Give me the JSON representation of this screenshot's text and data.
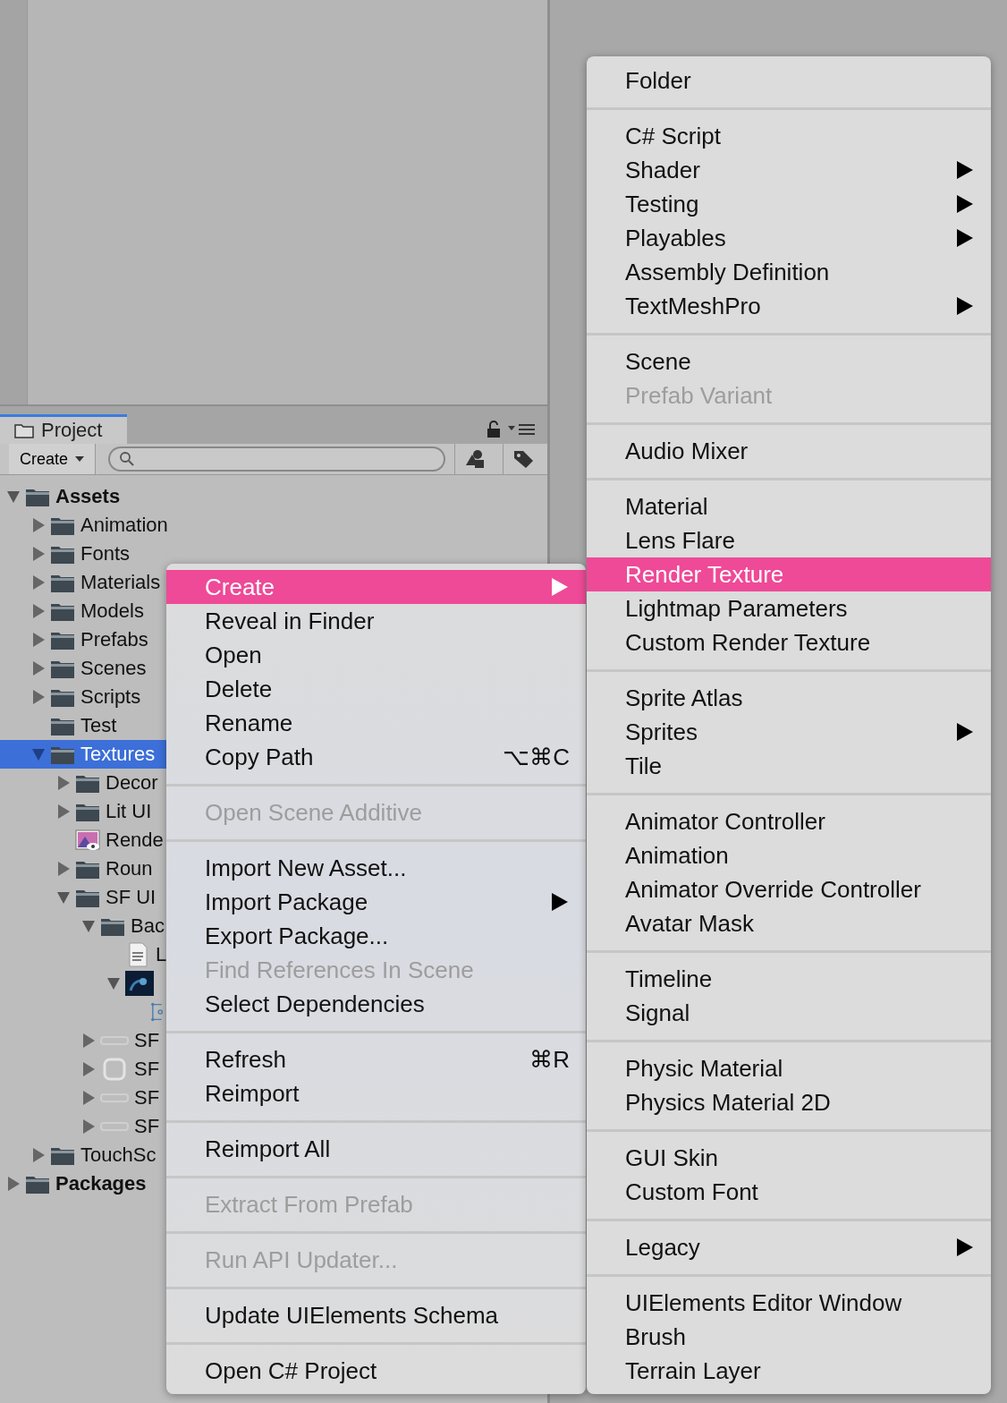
{
  "project": {
    "tab": {
      "label": "Project",
      "selected": true
    },
    "toolbar": {
      "create_label": "Create"
    },
    "tree": [
      {
        "label": "Assets",
        "kind": "folder",
        "expanded": true,
        "selected": false,
        "children": [
          {
            "label": "Animation",
            "kind": "folder",
            "expanded": false,
            "selected": false
          },
          {
            "label": "Fonts",
            "kind": "folder",
            "expanded": false,
            "selected": false
          },
          {
            "label": "Materials",
            "kind": "folder",
            "expanded": false,
            "selected": false
          },
          {
            "label": "Models",
            "kind": "folder",
            "expanded": false,
            "selected": false
          },
          {
            "label": "Prefabs",
            "kind": "folder",
            "expanded": false,
            "selected": false
          },
          {
            "label": "Scenes",
            "kind": "folder",
            "expanded": false,
            "selected": false
          },
          {
            "label": "Scripts",
            "kind": "folder",
            "expanded": false,
            "selected": false
          },
          {
            "label": "Test",
            "kind": "folder",
            "selected": false
          },
          {
            "label": "Textures",
            "kind": "folder",
            "expanded": true,
            "selected": true,
            "children": [
              {
                "label": "Decor",
                "kind": "folder",
                "expanded": false,
                "selected": false
              },
              {
                "label": "Lit UI",
                "kind": "folder",
                "expanded": false,
                "selected": false
              },
              {
                "label": "Rende",
                "kind": "render-texture",
                "selected": false
              },
              {
                "label": "Roun",
                "kind": "folder",
                "expanded": false,
                "selected": false
              },
              {
                "label": "SF UI",
                "kind": "folder",
                "expanded": true,
                "selected": false,
                "children": [
                  {
                    "label": "Bac",
                    "kind": "folder",
                    "expanded": true,
                    "selected": false,
                    "children": [
                      {
                        "label": "L",
                        "kind": "document",
                        "selected": false
                      },
                      {
                        "kind": "image",
                        "expanded": true,
                        "selected": false,
                        "children": [
                          {
                            "kind": "sprite",
                            "selected": false
                          }
                        ]
                      }
                    ]
                  },
                  {
                    "label": "SF",
                    "kind": "bar",
                    "expanded": false,
                    "selected": false
                  },
                  {
                    "label": "SF",
                    "kind": "frame",
                    "expanded": false,
                    "selected": false
                  },
                  {
                    "label": "SF",
                    "kind": "bar",
                    "expanded": false,
                    "selected": false
                  },
                  {
                    "label": "SF",
                    "kind": "bar",
                    "expanded": false,
                    "selected": false
                  }
                ]
              }
            ]
          },
          {
            "label": "TouchSc",
            "kind": "folder",
            "expanded": false,
            "selected": false
          }
        ]
      },
      {
        "label": "Packages",
        "kind": "folder",
        "expanded": false,
        "selected": false
      }
    ]
  },
  "context_menu": {
    "groups": [
      {
        "items": [
          {
            "label": "Create",
            "selected": true,
            "disabled": false,
            "submenu": true
          },
          {
            "label": "Reveal in Finder",
            "selected": false,
            "disabled": false,
            "submenu": false
          },
          {
            "label": "Open",
            "selected": false,
            "disabled": false,
            "submenu": false
          },
          {
            "label": "Delete",
            "selected": false,
            "disabled": false,
            "submenu": false
          },
          {
            "label": "Rename",
            "selected": false,
            "disabled": false,
            "submenu": false
          },
          {
            "label": "Copy Path",
            "shortcut": "⌥⌘C",
            "selected": false,
            "disabled": false,
            "submenu": false
          }
        ]
      },
      {
        "items": [
          {
            "label": "Open Scene Additive",
            "selected": false,
            "disabled": true,
            "submenu": false
          }
        ]
      },
      {
        "items": [
          {
            "label": "Import New Asset...",
            "selected": false,
            "disabled": false,
            "submenu": false
          },
          {
            "label": "Import Package",
            "selected": false,
            "disabled": false,
            "submenu": true
          },
          {
            "label": "Export Package...",
            "selected": false,
            "disabled": false,
            "submenu": false
          },
          {
            "label": "Find References In Scene",
            "selected": false,
            "disabled": true,
            "submenu": false
          },
          {
            "label": "Select Dependencies",
            "selected": false,
            "disabled": false,
            "submenu": false
          }
        ]
      },
      {
        "items": [
          {
            "label": "Refresh",
            "shortcut": "⌘R",
            "selected": false,
            "disabled": false,
            "submenu": false
          },
          {
            "label": "Reimport",
            "selected": false,
            "disabled": false,
            "submenu": false
          }
        ]
      },
      {
        "items": [
          {
            "label": "Reimport All",
            "selected": false,
            "disabled": false,
            "submenu": false
          }
        ]
      },
      {
        "items": [
          {
            "label": "Extract From Prefab",
            "selected": false,
            "disabled": true,
            "submenu": false
          }
        ]
      },
      {
        "items": [
          {
            "label": "Run API Updater...",
            "selected": false,
            "disabled": true,
            "submenu": false
          }
        ]
      },
      {
        "items": [
          {
            "label": "Update UIElements Schema",
            "selected": false,
            "disabled": false,
            "submenu": false
          }
        ]
      },
      {
        "items": [
          {
            "label": "Open C# Project",
            "selected": false,
            "disabled": false,
            "submenu": false
          }
        ]
      }
    ]
  },
  "create_submenu": {
    "groups": [
      {
        "items": [
          {
            "label": "Folder",
            "selected": false,
            "disabled": false,
            "submenu": false
          }
        ]
      },
      {
        "items": [
          {
            "label": "C# Script",
            "selected": false,
            "disabled": false,
            "submenu": false
          },
          {
            "label": "Shader",
            "selected": false,
            "disabled": false,
            "submenu": true
          },
          {
            "label": "Testing",
            "selected": false,
            "disabled": false,
            "submenu": true
          },
          {
            "label": "Playables",
            "selected": false,
            "disabled": false,
            "submenu": true
          },
          {
            "label": "Assembly Definition",
            "selected": false,
            "disabled": false,
            "submenu": false
          },
          {
            "label": "TextMeshPro",
            "selected": false,
            "disabled": false,
            "submenu": true
          }
        ]
      },
      {
        "items": [
          {
            "label": "Scene",
            "selected": false,
            "disabled": false,
            "submenu": false
          },
          {
            "label": "Prefab Variant",
            "selected": false,
            "disabled": true,
            "submenu": false
          }
        ]
      },
      {
        "items": [
          {
            "label": "Audio Mixer",
            "selected": false,
            "disabled": false,
            "submenu": false
          }
        ]
      },
      {
        "items": [
          {
            "label": "Material",
            "selected": false,
            "disabled": false,
            "submenu": false
          },
          {
            "label": "Lens Flare",
            "selected": false,
            "disabled": false,
            "submenu": false
          },
          {
            "label": "Render Texture",
            "selected": true,
            "disabled": false,
            "submenu": false
          },
          {
            "label": "Lightmap Parameters",
            "selected": false,
            "disabled": false,
            "submenu": false
          },
          {
            "label": "Custom Render Texture",
            "selected": false,
            "disabled": false,
            "submenu": false
          }
        ]
      },
      {
        "items": [
          {
            "label": "Sprite Atlas",
            "selected": false,
            "disabled": false,
            "submenu": false
          },
          {
            "label": "Sprites",
            "selected": false,
            "disabled": false,
            "submenu": true
          },
          {
            "label": "Tile",
            "selected": false,
            "disabled": false,
            "submenu": false
          }
        ]
      },
      {
        "items": [
          {
            "label": "Animator Controller",
            "selected": false,
            "disabled": false,
            "submenu": false
          },
          {
            "label": "Animation",
            "selected": false,
            "disabled": false,
            "submenu": false
          },
          {
            "label": "Animator Override Controller",
            "selected": false,
            "disabled": false,
            "submenu": false
          },
          {
            "label": "Avatar Mask",
            "selected": false,
            "disabled": false,
            "submenu": false
          }
        ]
      },
      {
        "items": [
          {
            "label": "Timeline",
            "selected": false,
            "disabled": false,
            "submenu": false
          },
          {
            "label": "Signal",
            "selected": false,
            "disabled": false,
            "submenu": false
          }
        ]
      },
      {
        "items": [
          {
            "label": "Physic Material",
            "selected": false,
            "disabled": false,
            "submenu": false
          },
          {
            "label": "Physics Material 2D",
            "selected": false,
            "disabled": false,
            "submenu": false
          }
        ]
      },
      {
        "items": [
          {
            "label": "GUI Skin",
            "selected": false,
            "disabled": false,
            "submenu": false
          },
          {
            "label": "Custom Font",
            "selected": false,
            "disabled": false,
            "submenu": false
          }
        ]
      },
      {
        "items": [
          {
            "label": "Legacy",
            "selected": false,
            "disabled": false,
            "submenu": true
          }
        ]
      },
      {
        "items": [
          {
            "label": "UIElements Editor Window",
            "selected": false,
            "disabled": false,
            "submenu": false
          },
          {
            "label": "Brush",
            "selected": false,
            "disabled": false,
            "submenu": false
          },
          {
            "label": "Terrain Layer",
            "selected": false,
            "disabled": false,
            "submenu": false
          }
        ]
      }
    ]
  }
}
